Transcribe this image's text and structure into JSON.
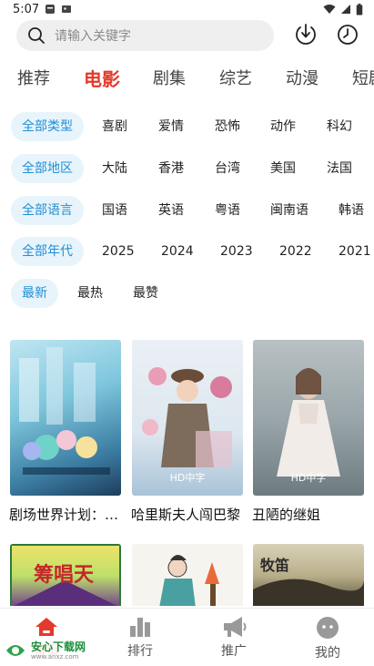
{
  "status": {
    "time": "5:07"
  },
  "search": {
    "placeholder": "请输入关键字"
  },
  "tabs": [
    "推荐",
    "电影",
    "剧集",
    "综艺",
    "动漫",
    "短剧"
  ],
  "filters": {
    "type": [
      "全部类型",
      "喜剧",
      "爱情",
      "恐怖",
      "动作",
      "科幻"
    ],
    "region": [
      "全部地区",
      "大陆",
      "香港",
      "台湾",
      "美国",
      "法国"
    ],
    "language": [
      "全部语言",
      "国语",
      "英语",
      "粤语",
      "闽南语",
      "韩语"
    ],
    "year": [
      "全部年代",
      "2025",
      "2024",
      "2023",
      "2022",
      "2021"
    ],
    "sort": [
      "最新",
      "最热",
      "最赞"
    ]
  },
  "movies": [
    {
      "title": "剧场世界计划：坏掉的世界与唱不出的未来",
      "tag": ""
    },
    {
      "title": "哈里斯夫人闯巴黎",
      "tag": "HD中字"
    },
    {
      "title": "丑陋的继姐",
      "tag": "HD中字"
    },
    {
      "title": "筹唱天",
      "tag": ""
    },
    {
      "title": "",
      "tag": ""
    },
    {
      "title": "牧笛",
      "tag": ""
    }
  ],
  "nav": [
    {
      "label": "首页",
      "icon": "home-icon"
    },
    {
      "label": "排行",
      "icon": "bar-chart-icon"
    },
    {
      "label": "推广",
      "icon": "megaphone-icon"
    },
    {
      "label": "我的",
      "icon": "profile-icon"
    }
  ],
  "watermark": {
    "title": "安心下载网",
    "url": "www.anxz.com"
  },
  "colors": {
    "accent": "#e33a2c",
    "chip_selected_text": "#1f8fd6",
    "chip_selected_bg": "#e8f4fb"
  }
}
